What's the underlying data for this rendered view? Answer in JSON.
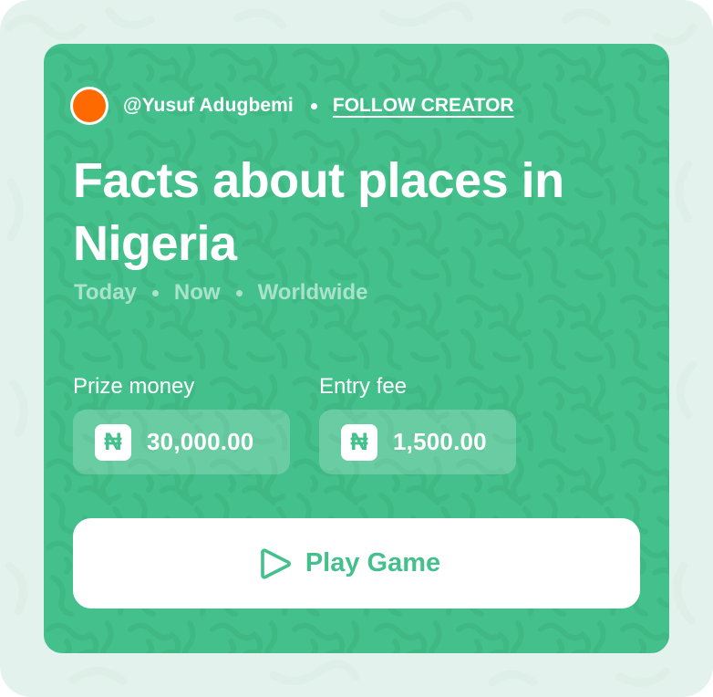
{
  "creator": {
    "handle": "@Yusuf Adugbemi",
    "follow_label": "FOLLOW CREATOR",
    "avatar_color": "#ff6a00"
  },
  "game": {
    "title": "Facts about places in Nigeria",
    "meta": [
      "Today",
      "Now",
      "Worldwide"
    ]
  },
  "stats": {
    "prize": {
      "label": "Prize money",
      "currency_symbol": "₦",
      "value": "30,000.00"
    },
    "entry": {
      "label": "Entry fee",
      "currency_symbol": "₦",
      "value": "1,500.00"
    }
  },
  "actions": {
    "play_label": "Play Game",
    "play_icon": "play-icon"
  },
  "colors": {
    "card_green": "#44c08d",
    "outer_background": "#e3f2ec",
    "accent_orange": "#ff6a00",
    "white": "#ffffff"
  }
}
